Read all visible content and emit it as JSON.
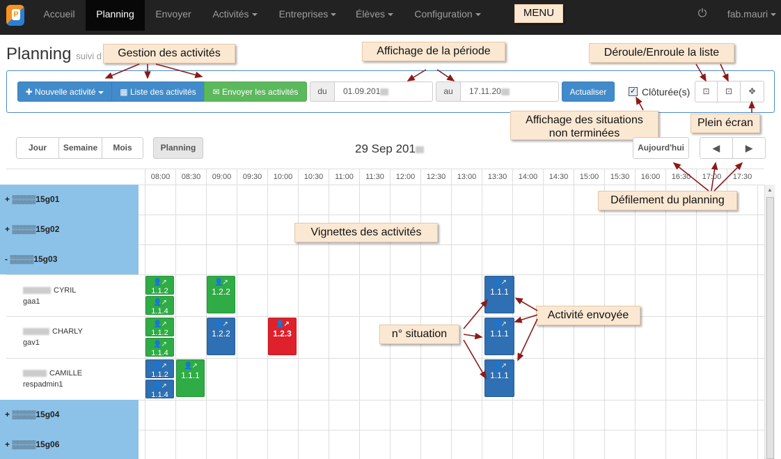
{
  "nav": {
    "items": [
      {
        "label": "Accueil",
        "caret": false
      },
      {
        "label": "Planning",
        "caret": false,
        "active": true
      },
      {
        "label": "Envoyer",
        "caret": false
      },
      {
        "label": "Activités",
        "caret": true
      },
      {
        "label": "Entreprises",
        "caret": true
      },
      {
        "label": "Élèves",
        "caret": true
      },
      {
        "label": "Configuration",
        "caret": true
      }
    ],
    "menu_callout": "MENU",
    "user": "fab.mauri"
  },
  "page": {
    "title": "Planning",
    "subtitle": "suivi d"
  },
  "toolbar": {
    "new_activity": "Nouvelle activité",
    "list_activities": "Liste des activités",
    "send_activities": "Envoyer les activités",
    "from_label": "du",
    "from_value": "01.09.201",
    "to_label": "au",
    "to_value": "17.11.20",
    "refresh": "Actualiser",
    "closed_label": "Clôturée(s)",
    "closed_checked": true
  },
  "calendar": {
    "view_day": "Jour",
    "view_week": "Semaine",
    "view_month": "Mois",
    "view_planning": "Planning",
    "date": "29 Sep 201",
    "today": "Aujourd'hui",
    "times": [
      "08:00",
      "08:30",
      "09:00",
      "09:30",
      "10:00",
      "10:30",
      "11:00",
      "11:30",
      "12:00",
      "12:30",
      "13:00",
      "13:30",
      "14:00",
      "14:30",
      "15:00",
      "15:30",
      "16:00",
      "16:30",
      "17:00",
      "17:30"
    ]
  },
  "groups": [
    {
      "label": "+ ▒▒▒▒15g01"
    },
    {
      "label": "+ ▒▒▒▒15g02"
    },
    {
      "label": "- ▒▒▒▒15g03"
    },
    {
      "label": "+ ▒▒▒▒15g04"
    },
    {
      "label": "+ ▒▒▒▒15g06"
    }
  ],
  "people": [
    {
      "name": "CYRIL",
      "code": "gaa1"
    },
    {
      "name": "CHARLY",
      "code": "gav1"
    },
    {
      "name": "CAMILLE",
      "code": "respadmin1"
    }
  ],
  "tiles": {
    "t1": "1.1.2",
    "t2": "1.1.4",
    "t3": "1.2.2",
    "t4": "1.1.1",
    "t5": "1.2.2",
    "t6": "1.1.2",
    "t7": "1.1.4",
    "t8": "1.2.3",
    "t9": "1.1.1",
    "t10": "1.1.2",
    "t11": "1.1.4",
    "t12": "1.1.1",
    "t13": "1.1.1"
  },
  "callouts": {
    "gestion": "Gestion des activités",
    "affichage": "Affichage de la période",
    "deroule": "Déroule/Enroule la liste",
    "situations_1": "Affichage des situations",
    "situations_2": "non terminées",
    "plein_ecran": "Plein écran",
    "defilement": "Défilement du planning",
    "vignettes": "Vignettes des activités",
    "envoyee": "Activité envoyée",
    "situation": "n° situation"
  },
  "colors": {
    "group_bg": "#8dc2e8",
    "green": "#2fac45",
    "blue": "#2f6fb3",
    "red": "#e0202a",
    "navbar": "#222222"
  }
}
